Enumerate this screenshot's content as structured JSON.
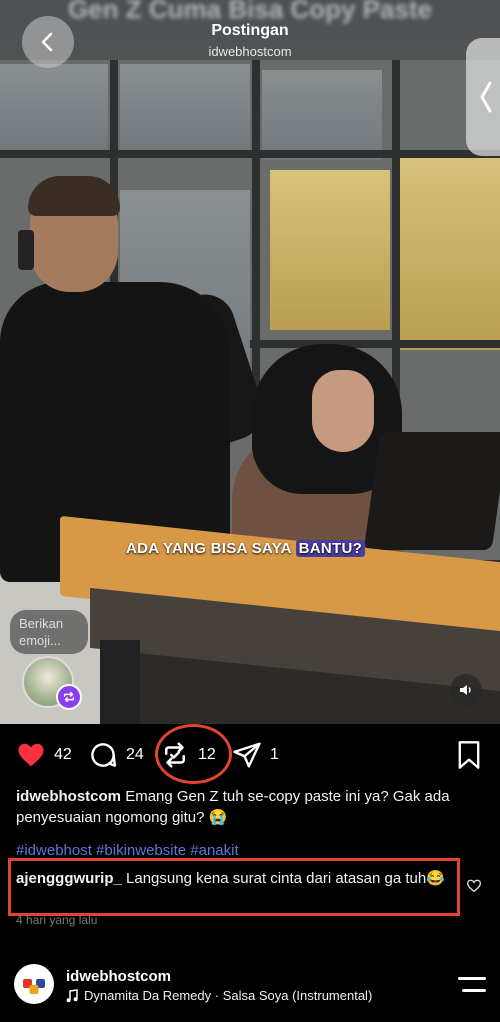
{
  "video": {
    "blurred_title": "Gen Z Cuma Bisa Copy Paste",
    "overlay_caption_pre": "ADA YANG BISA SAYA ",
    "overlay_caption_hl": "BANTU?",
    "emoji_prompt": "Berikan emoji..."
  },
  "header": {
    "title": "Postingan",
    "subtitle": "idwebhostcom"
  },
  "actions": {
    "likes": "42",
    "comments": "24",
    "reposts": "12",
    "shares": "1"
  },
  "post": {
    "author": "idwebhostcom",
    "text": "Emang Gen Z tuh se-copy paste ini ya? Gak ada penyesuaian ngomong gitu? 😭",
    "hashtags": "#idwebhost #bikinwebsite #anakit"
  },
  "comment": {
    "author": "ajengggwurip_",
    "text": "Langsung kena surat cinta dari atasan ga tuh😂",
    "time": "4 hari yang lalu"
  },
  "footer": {
    "account": "idwebhostcom",
    "music": "Dynamita Da Remedy · Salsa Soya (Instrumental)"
  },
  "colors": {
    "like": "#ff3040",
    "highlight": "#e0452f",
    "hashtag": "#5b77d8",
    "repost_badge": "#8b3df0"
  },
  "icons": [
    "back-icon",
    "chevron-left-icon",
    "heart-icon",
    "comment-icon",
    "repost-icon",
    "share-icon",
    "bookmark-icon",
    "volume-icon",
    "music-icon",
    "menu-icon"
  ]
}
